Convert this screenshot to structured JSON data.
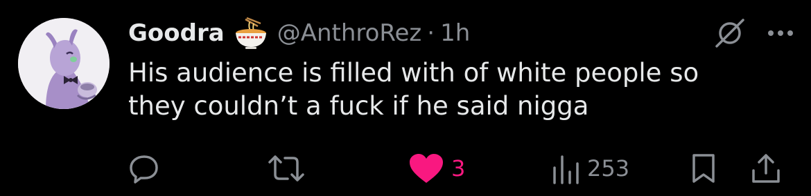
{
  "tweet": {
    "display_name": "Goodra",
    "emoji": "ramen-bowl-emoji",
    "handle": "@AnthroRez",
    "separator": "·",
    "time": "1h",
    "text_line1": "His audience is filled with of white people so",
    "text_line2": "they couldn’t a fuck if he said nigga"
  },
  "actions": {
    "reply_icon": "reply-bubble-icon",
    "retweet_icon": "retweet-icon",
    "like_icon": "heart-filled-icon",
    "like_count": "3",
    "views_icon": "views-bar-chart-icon",
    "views_count": "253",
    "bookmark_icon": "bookmark-icon",
    "share_icon": "share-upload-icon"
  },
  "header_actions": {
    "grok_icon": "grok-slash-icon",
    "more_icon": "more-dots-icon"
  },
  "colors": {
    "background": "#000000",
    "text": "#e7e9ea",
    "muted": "#8b8f95",
    "like_pink": "#f91880"
  }
}
